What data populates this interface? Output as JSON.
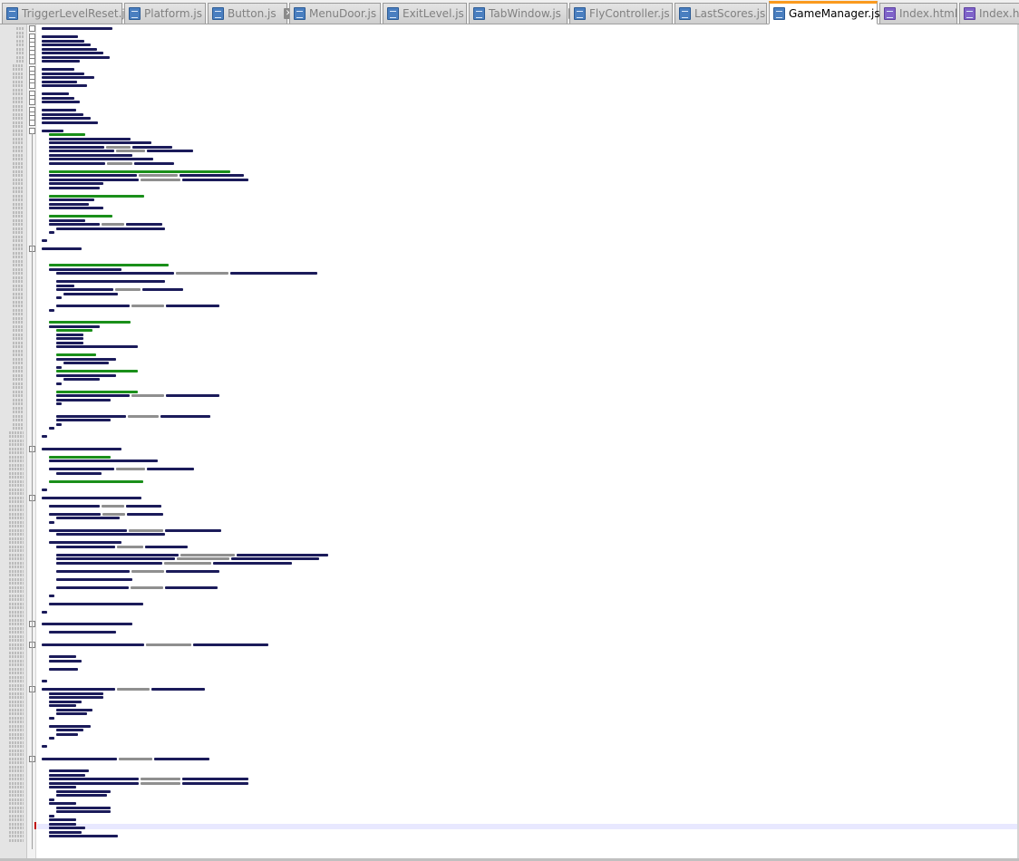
{
  "tabs": [
    {
      "label": "TriggerLevelReset.js",
      "icon": "js-file-icon",
      "active": false
    },
    {
      "label": "Platform.js",
      "icon": "js-file-icon",
      "active": false
    },
    {
      "label": "Button.js",
      "icon": "js-file-icon",
      "active": false
    },
    {
      "label": "MenuDoor.js",
      "icon": "js-file-icon",
      "active": false
    },
    {
      "label": "ExitLevel.js",
      "icon": "js-file-icon",
      "active": false
    },
    {
      "label": "TabWindow.js",
      "icon": "js-file-icon",
      "active": false
    },
    {
      "label": "FlyController.js",
      "icon": "js-file-icon",
      "active": false
    },
    {
      "label": "LastScores.js",
      "icon": "js-file-icon",
      "active": false
    },
    {
      "label": "GameManager.js",
      "icon": "js-file-icon",
      "active": true
    },
    {
      "label": "Index.html",
      "icon": "html-file-icon",
      "active": false
    },
    {
      "label": "Index.html",
      "icon": "html-file-icon",
      "active": false
    }
  ],
  "close_glyph": "✕",
  "colors": {
    "active_tab_accent": "#fa9a1e",
    "active_close": "#e0454b",
    "code_text": "#1b1b5a",
    "comment": "#1a8f1a",
    "string": "#8f8f8f",
    "number": "#c72020",
    "current_line": "#e8e8ff"
  }
}
